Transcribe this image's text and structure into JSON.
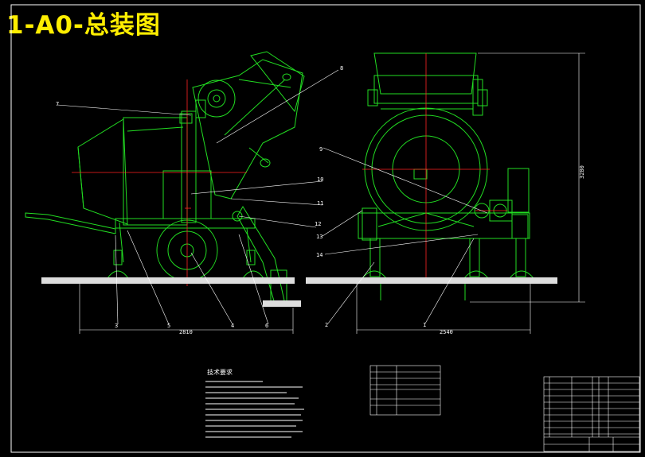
{
  "title": "1-A0-总装图",
  "colors": {
    "background": "#000000",
    "title": "#ffee00",
    "machine": "#22dd22",
    "centerline": "#ff2222",
    "dimension": "#ffffff"
  },
  "callouts": {
    "c1": "1",
    "c2": "2",
    "c3": "3",
    "c4": "4",
    "c5": "5",
    "c6": "6",
    "c7": "7",
    "c8": "8",
    "c9": "9",
    "c10": "10",
    "c11": "11",
    "c12": "12",
    "c13": "13",
    "c14": "14"
  },
  "dimensions": {
    "side_width": "2810",
    "front_width": "2540",
    "height": "3280"
  },
  "tech_requirements_title": "技术要求"
}
